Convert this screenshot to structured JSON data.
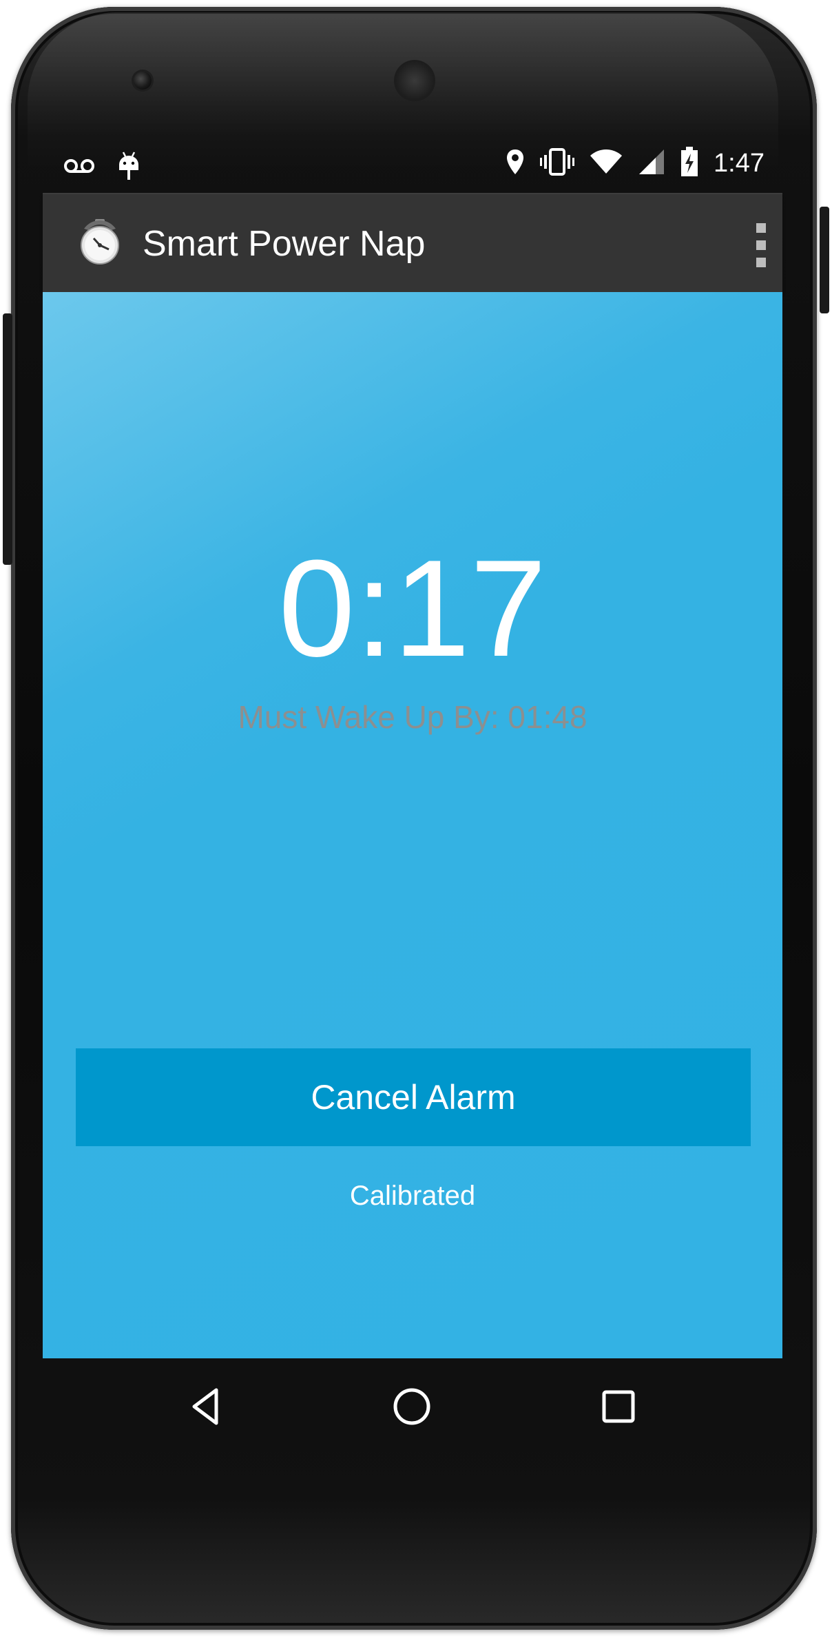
{
  "status_bar": {
    "time": "1:47",
    "left_icons": [
      "voicemail-icon",
      "android-debug-icon"
    ],
    "right_icons": [
      "location-icon",
      "vibrate-icon",
      "wifi-icon",
      "signal-icon",
      "battery-charging-icon"
    ]
  },
  "action_bar": {
    "title": "Smart Power Nap",
    "app_icon": "stopwatch-icon",
    "menu_icon": "overflow-menu-icon"
  },
  "main": {
    "countdown": "0:17",
    "wake_label": "Must Wake Up By: 01:48",
    "cancel_button_label": "Cancel Alarm",
    "status_text": "Calibrated"
  },
  "nav_bar": {
    "icons": [
      "back-icon",
      "home-icon",
      "recents-icon"
    ]
  },
  "colors": {
    "content_background": "#33b2e4",
    "button_background": "#0097cc",
    "action_bar": "#343434",
    "wake_label": "#8c8f90"
  }
}
